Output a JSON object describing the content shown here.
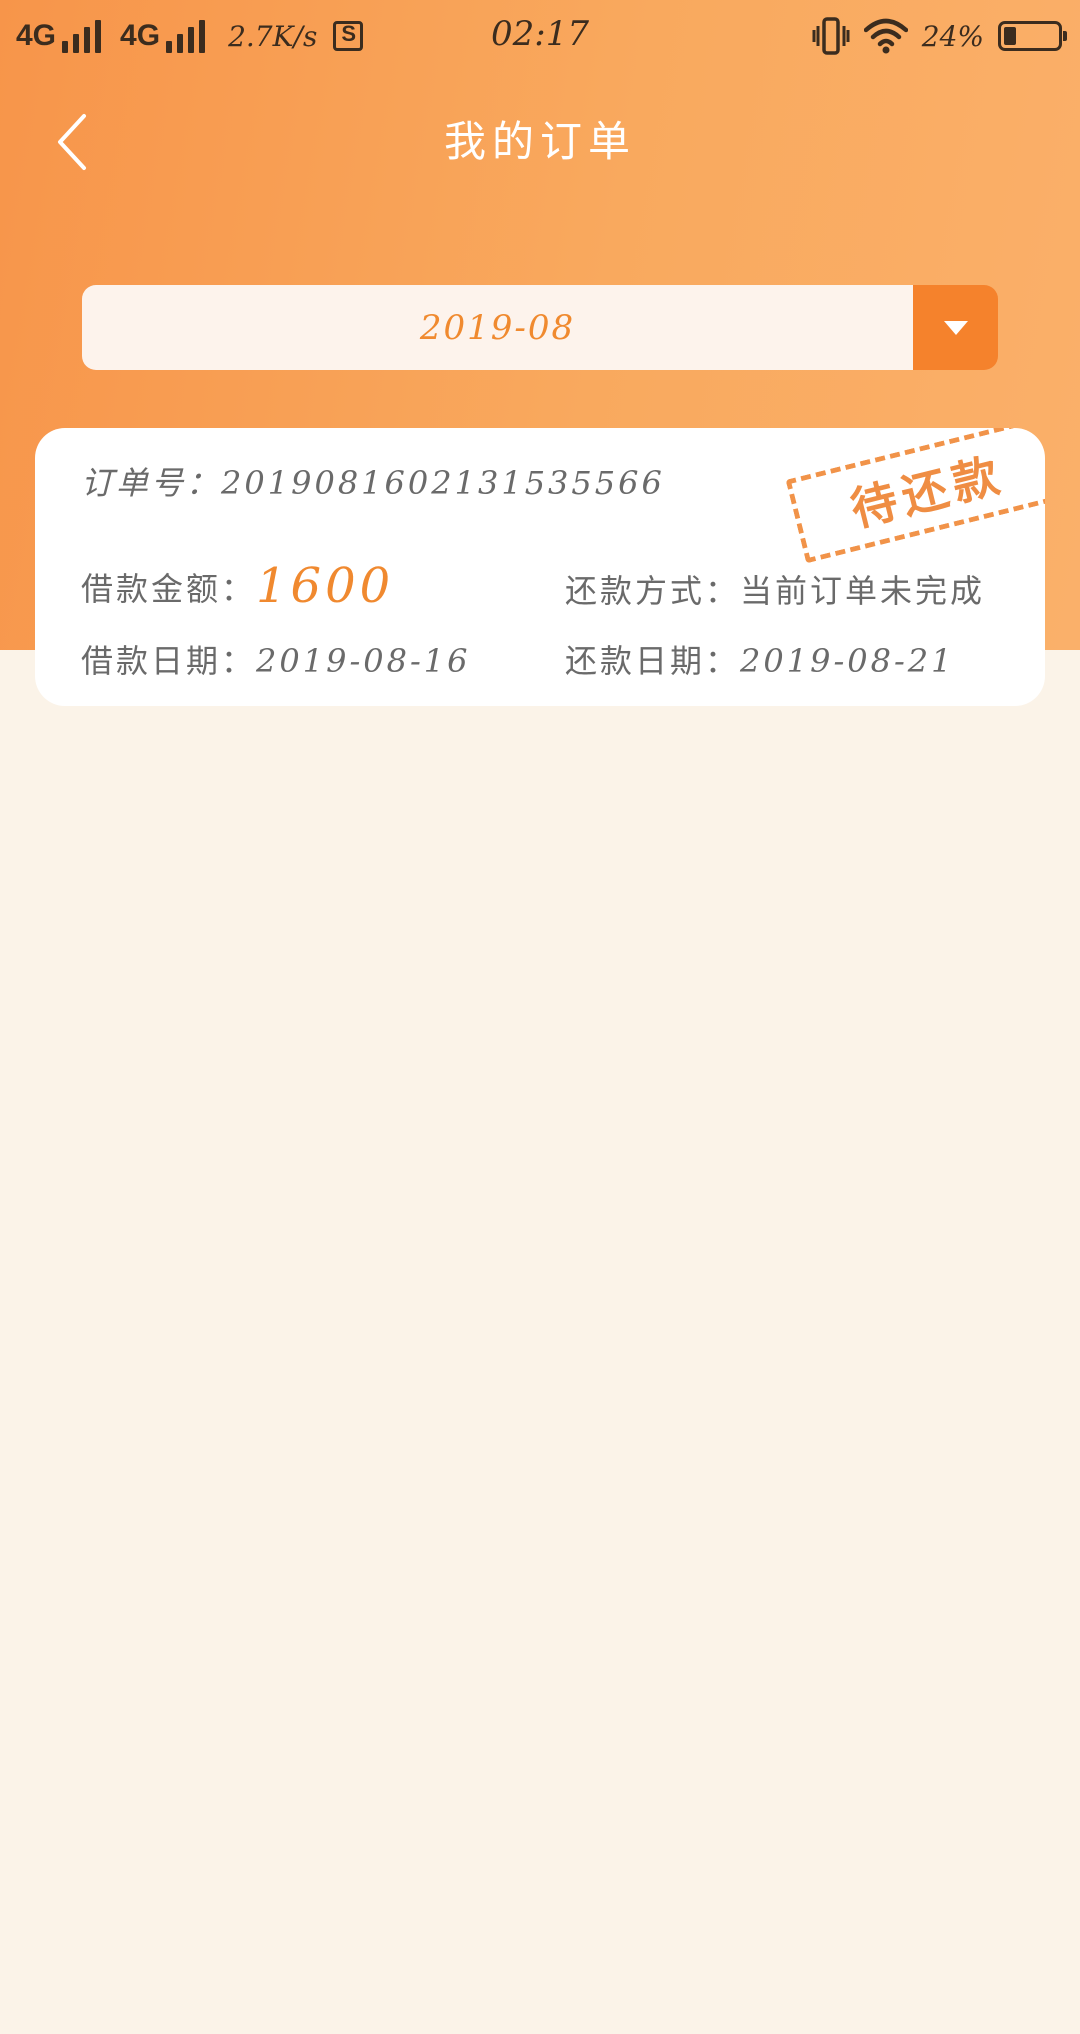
{
  "status_bar": {
    "network_1": "4G",
    "network_2": "4G",
    "speed": "2.7K/s",
    "time": "02:17",
    "battery_pct": "24%",
    "battery_level": 0.24,
    "icons": [
      "signal-icon",
      "app-notification-icon",
      "vibrate-icon",
      "wifi-icon",
      "battery-icon"
    ]
  },
  "header": {
    "title": "我的订单",
    "back_icon": "chevron-left-icon"
  },
  "month_selector": {
    "value": "2019-08",
    "dropdown_icon": "caret-down-icon"
  },
  "order": {
    "order_no_label": "订单号：",
    "order_no": "2019081602131535566",
    "status_stamp": "待还款",
    "amount_label": "借款金额：",
    "amount": "1600",
    "repay_method_label": "还款方式：",
    "repay_method": "当前订单未完成",
    "loan_date_label": "借款日期：",
    "loan_date": "2019-08-16",
    "repay_date_label": "还款日期：",
    "repay_date": "2019-08-21"
  },
  "colors": {
    "header_gradient_start": "#f7954a",
    "header_gradient_end": "#fab06a",
    "accent": "#f5822c",
    "page_bg": "#fbf3e8",
    "card_bg": "#ffffff",
    "text_gray": "#6a6a6a"
  }
}
